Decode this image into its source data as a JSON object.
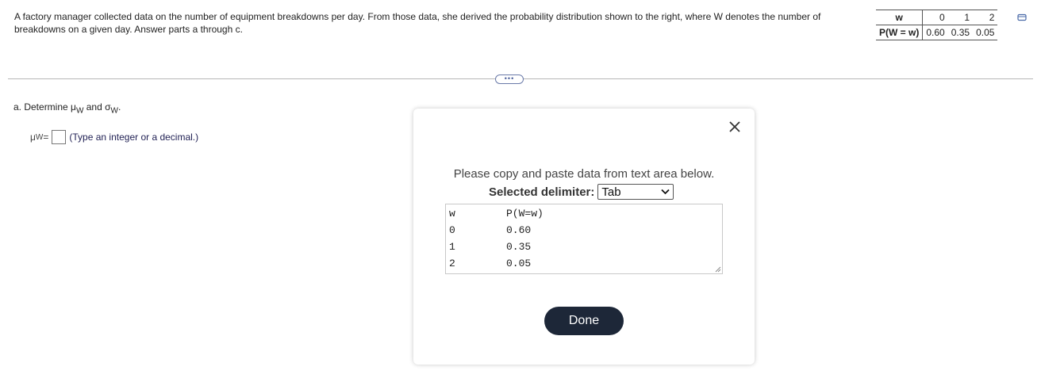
{
  "problem": {
    "text": "A factory manager collected data on the number of equipment breakdowns per day. From those data, she derived the probability distribution shown to the right, where W denotes the number of breakdowns on a given day. Answer parts a through c."
  },
  "distribution_table": {
    "header_w": "w",
    "header_p": "P(W = w)",
    "w_values": [
      "0",
      "1",
      "2"
    ],
    "p_values": [
      "0.60",
      "0.35",
      "0.05"
    ],
    "copy_icon": "copy-icon"
  },
  "more_button": {
    "label": "•••"
  },
  "part_a": {
    "prefix": "a. Determine ",
    "mu": "μ",
    "sub_w": "W",
    "and": " and ",
    "sigma": "σ",
    "suffix": "."
  },
  "answer": {
    "mu": "μ",
    "sub": "W",
    "equals": " = ",
    "hint": "(Type an integer or a decimal.)"
  },
  "dialog": {
    "instruction": "Please copy and paste data from text area below.",
    "delimiter_label": "Selected delimiter:",
    "delimiter_value": "Tab",
    "rows": [
      {
        "c1": "w",
        "c2": "P(W=w)"
      },
      {
        "c1": "0",
        "c2": "0.60"
      },
      {
        "c1": "1",
        "c2": "0.35"
      },
      {
        "c1": "2",
        "c2": "0.05"
      }
    ],
    "done_label": "Done",
    "close_icon": "close-icon"
  }
}
